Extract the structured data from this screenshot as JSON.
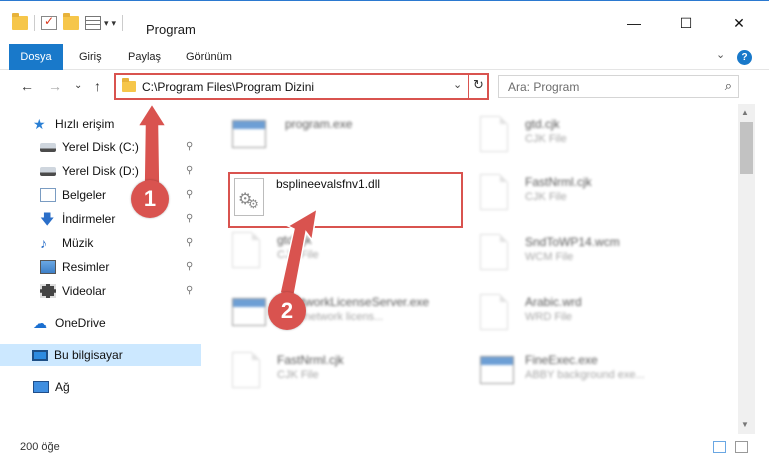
{
  "window": {
    "title": "Program",
    "minimize": "—",
    "maximize": "☐",
    "close": "✕"
  },
  "ribbon": {
    "tabs": [
      "Dosya",
      "Giriş",
      "Paylaş",
      "Görünüm"
    ],
    "expand": "⌄",
    "help": "?"
  },
  "navigation": {
    "back": "←",
    "forward": "→",
    "recent": "⌄",
    "up": "↑",
    "address": "C:\\Program Files\\Program Dizini",
    "address_chevron": "⌄",
    "refresh": "↻",
    "search_placeholder": "Ara: Program",
    "search_icon": "⌕"
  },
  "sidebar": {
    "items": [
      {
        "label": "Hızlı erişim",
        "icon": "star-icon",
        "pinned": false
      },
      {
        "label": "Yerel Disk (C:)",
        "icon": "drive-icon",
        "pinned": true
      },
      {
        "label": "Yerel Disk (D:)",
        "icon": "drive-icon",
        "pinned": true
      },
      {
        "label": "Belgeler",
        "icon": "documents-icon",
        "pinned": true
      },
      {
        "label": "İndirmeler",
        "icon": "downloads-icon",
        "pinned": true
      },
      {
        "label": "Müzik",
        "icon": "music-icon",
        "pinned": true
      },
      {
        "label": "Resimler",
        "icon": "pictures-icon",
        "pinned": true
      },
      {
        "label": "Videolar",
        "icon": "videos-icon",
        "pinned": true
      },
      {
        "label": "OneDrive",
        "icon": "onedrive-icon",
        "pinned": false
      },
      {
        "label": "Bu bilgisayar",
        "icon": "this-pc-icon",
        "pinned": false,
        "selected": true
      },
      {
        "label": "Ağ",
        "icon": "network-icon",
        "pinned": false
      }
    ],
    "pin_glyph": "📌"
  },
  "files": {
    "left": [
      {
        "name": "program.exe",
        "type": ""
      },
      {
        "name": "bsplineevalsfnv1.dll",
        "type": ""
      },
      {
        "name": "gtd.cjk",
        "type": "CJK File"
      },
      {
        "name": "...etworkLicenseServer.exe",
        "type": "...Y network licens..."
      },
      {
        "name": "FastNrml.cjk",
        "type": "CJK File"
      }
    ],
    "right": [
      {
        "name": "gtd.cjk",
        "type": "CJK File"
      },
      {
        "name": "FastNrml.cjk",
        "type": "CJK File"
      },
      {
        "name": "SndToWP14.wcm",
        "type": "WCM File"
      },
      {
        "name": "Arabic.wrd",
        "type": "WRD File"
      },
      {
        "name": "FineExec.exe",
        "type": "ABBY background exe..."
      }
    ]
  },
  "status": {
    "item_count": "200 öğe"
  },
  "annotations": {
    "badge1": "1",
    "badge2": "2",
    "accent_color": "#d9534f"
  },
  "colors": {
    "file_tab": "#1979ca",
    "selected_bg": "#cce8ff"
  }
}
